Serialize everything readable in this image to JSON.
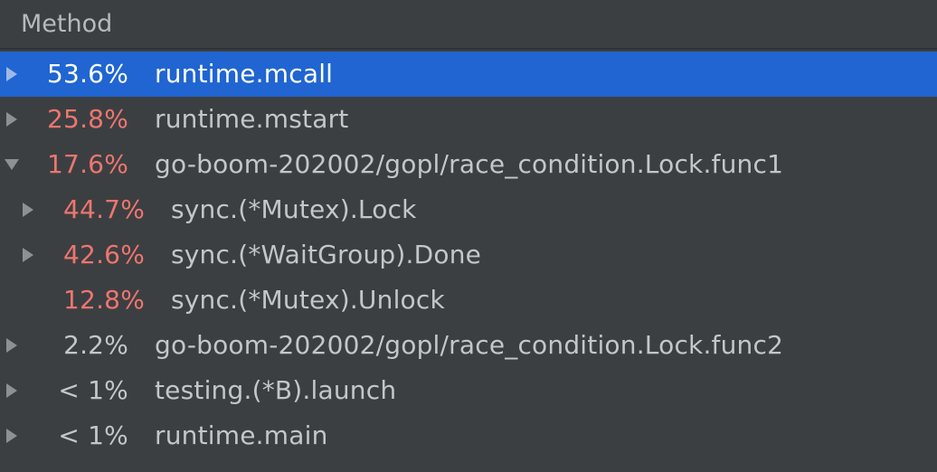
{
  "header": {
    "method_label": "Method"
  },
  "colors": {
    "background": "#3c3f41",
    "selection": "#2065d1",
    "hot_percent": "#ee7570",
    "text": "#c4c6c8"
  },
  "rows": [
    {
      "percent": "53.6%",
      "name": "runtime.mcall",
      "depth": 0,
      "toggle": "collapsed",
      "selected": true,
      "hot": false
    },
    {
      "percent": "25.8%",
      "name": "runtime.mstart",
      "depth": 0,
      "toggle": "collapsed",
      "selected": false,
      "hot": true
    },
    {
      "percent": "17.6%",
      "name": "go-boom-202002/gopl/race_condition.Lock.func1",
      "depth": 0,
      "toggle": "expanded",
      "selected": false,
      "hot": true
    },
    {
      "percent": "44.7%",
      "name": "sync.(*Mutex).Lock",
      "depth": 1,
      "toggle": "collapsed",
      "selected": false,
      "hot": true
    },
    {
      "percent": "42.6%",
      "name": "sync.(*WaitGroup).Done",
      "depth": 1,
      "toggle": "collapsed",
      "selected": false,
      "hot": true
    },
    {
      "percent": "12.8%",
      "name": "sync.(*Mutex).Unlock",
      "depth": 1,
      "toggle": "none",
      "selected": false,
      "hot": true
    },
    {
      "percent": "2.2%",
      "name": "go-boom-202002/gopl/race_condition.Lock.func2",
      "depth": 0,
      "toggle": "collapsed",
      "selected": false,
      "hot": false
    },
    {
      "percent": "< 1%",
      "name": "testing.(*B).launch",
      "depth": 0,
      "toggle": "collapsed",
      "selected": false,
      "hot": false
    },
    {
      "percent": "< 1%",
      "name": "runtime.main",
      "depth": 0,
      "toggle": "collapsed",
      "selected": false,
      "hot": false
    }
  ]
}
